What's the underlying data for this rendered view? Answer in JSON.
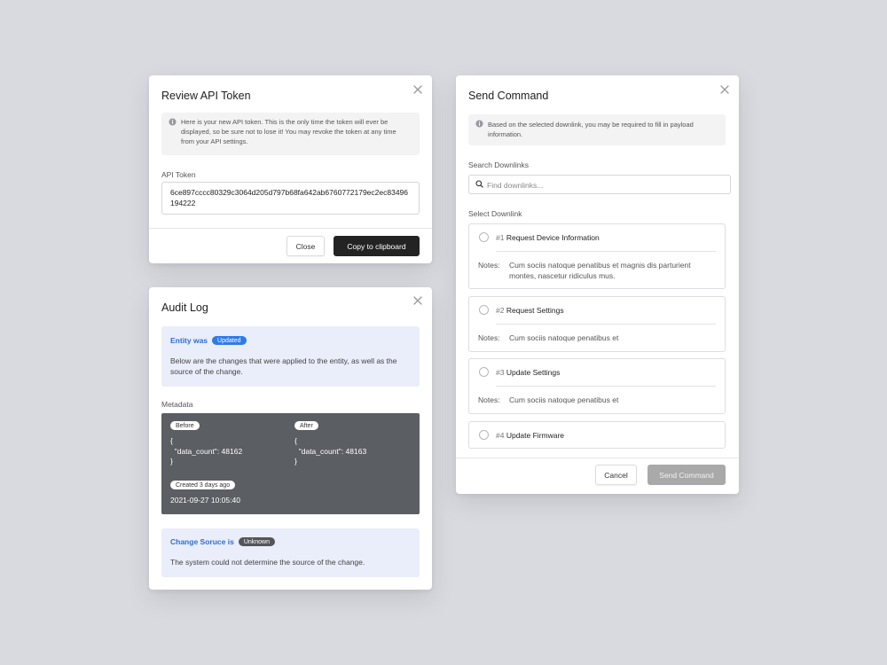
{
  "api_token_modal": {
    "title": "Review API Token",
    "info": "Here is your new API token. This is the only time the token will ever be displayed, so be sure not to lose it! You may revoke the token at any time from your API settings.",
    "token_label": "API Token",
    "token_value": "6ce897cccc80329c3064d205d797b68fa642ab6760772179ec2ec83496194222",
    "close_label": "Close",
    "copy_label": "Copy to clipboard"
  },
  "audit_log_modal": {
    "title": "Audit Log",
    "entity_heading": "Entity was",
    "entity_badge": "Updated",
    "entity_text": "Below are the changes that were applied to the entity, as well as the source of the change.",
    "metadata_label": "Metadata",
    "before_label": "Before",
    "before_code": "{\n  \"data_count\": 48162\n}",
    "after_label": "After",
    "after_code": "{\n  \"data_count\": 48163\n}",
    "created_label": "Created 3 days ago",
    "created_value": "2021-09-27 10:05:40",
    "source_heading": "Change Soruce is",
    "source_badge": "Unknown",
    "source_text": "The system could not determine the source of the change."
  },
  "send_command_modal": {
    "title": "Send Command",
    "info": "Based on the selected downlink, you may be required to fill in payload information.",
    "search_label": "Search Downlinks",
    "search_placeholder": "Find downlinks...",
    "select_label": "Select Downlink",
    "notes_label": "Notes:",
    "downlinks": [
      {
        "number": "#1",
        "name": "Request Device Information",
        "notes": "Cum sociis natoque penatibus et magnis dis parturient montes, nascetur ridiculus mus."
      },
      {
        "number": "#2",
        "name": "Request Settings",
        "notes": "Cum sociis natoque penatibus et"
      },
      {
        "number": "#3",
        "name": "Update Settings",
        "notes": "Cum sociis natoque penatibus et"
      },
      {
        "number": "#4",
        "name": "Update Firmware"
      }
    ],
    "cancel_label": "Cancel",
    "send_label": "Send Command"
  },
  "colors": {
    "background": "#d9dadf",
    "accent_blue": "#2f7be6",
    "primary_button": "#232323",
    "disabled_button": "#a9a9a9",
    "metadata_panel": "#5b5e62",
    "callout_background": "#eaedfa"
  },
  "icons": [
    "close-icon",
    "info-icon",
    "search-icon"
  ]
}
